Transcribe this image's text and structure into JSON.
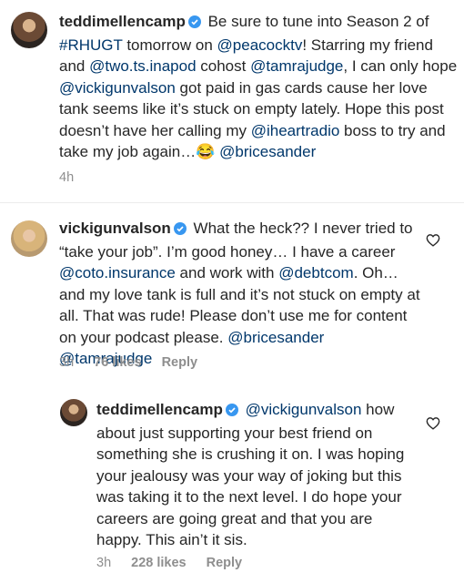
{
  "colors": {
    "text": "#262626",
    "mention": "#00376b",
    "meta": "#8e8e8e",
    "verified": "#3897f0"
  },
  "comments": [
    {
      "username": "teddimellencamp",
      "parts": [
        " Be sure to tune into Season 2 of ",
        "#RHUGT",
        " tomorrow on ",
        "@peacocktv",
        "! Starring my friend and ",
        "@two.ts.inapod",
        " cohost ",
        "@tamrajudge",
        ", I can only hope ",
        "@vickigunvalson",
        " got paid in gas cards cause her love tank seems like it’s stuck on empty lately. Hope this post doesn’t have her calling my ",
        "@iheartradio",
        " boss to try and take my job again…",
        "😂",
        " ",
        "@bricesander"
      ],
      "time": "4h"
    },
    {
      "username": "vickigunvalson",
      "parts": [
        " What the heck?? I never tried to “take your job”. I’m good honey… I have a career ",
        "@coto.insurance",
        " and work with ",
        "@debtcom",
        ".  Oh… and my love tank is full and it’s not stuck on empty at all.  That was rude! Please don’t use me for content on your podcast please.  ",
        "@bricesander",
        " ",
        "@tamrajudge"
      ],
      "time": "3h",
      "likes": "76 likes",
      "reply": "Reply"
    },
    {
      "username": "teddimellencamp",
      "parts": [
        " ",
        "@vickigunvalson",
        " how about just supporting your best friend on something she is crushing it on.  I was hoping your jealousy was your way of joking but this was taking it to the next level.  I do hope your careers are going great and that you are happy. This ain’t it sis."
      ],
      "time": "3h",
      "likes": "228 likes",
      "reply": "Reply"
    }
  ]
}
